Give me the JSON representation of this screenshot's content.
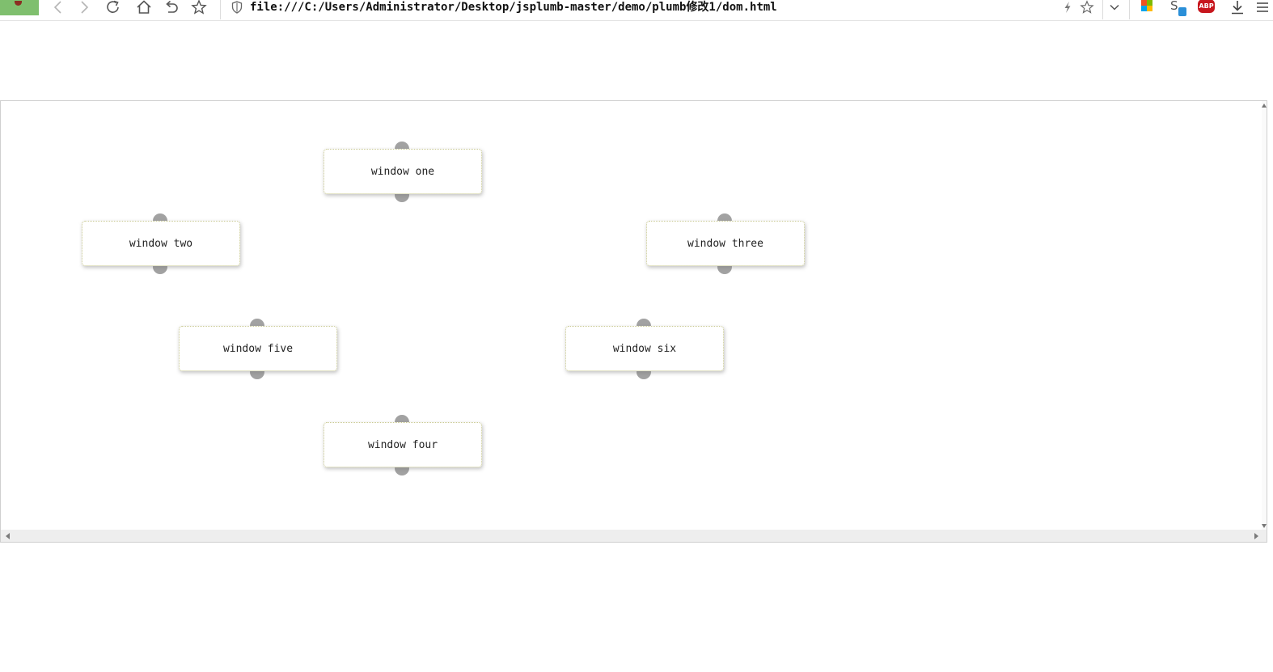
{
  "browser": {
    "address": "file:///C:/Users/Administrator/Desktop/jsplumb-master/demo/plumb修改1/dom.html",
    "extension_abp_label": "ABP",
    "extension_s_label": "S"
  },
  "nodes": [
    {
      "id": "window-one",
      "label": "window one"
    },
    {
      "id": "window-two",
      "label": "window two"
    },
    {
      "id": "window-three",
      "label": "window three"
    },
    {
      "id": "window-five",
      "label": "window five"
    },
    {
      "id": "window-six",
      "label": "window six"
    },
    {
      "id": "window-four",
      "label": "window four"
    }
  ],
  "colors": {
    "endpoint": "#a2a2a2",
    "node_border": "#c8c890",
    "tab_accent": "#7fbf6e",
    "abp_red": "#c7161d"
  }
}
